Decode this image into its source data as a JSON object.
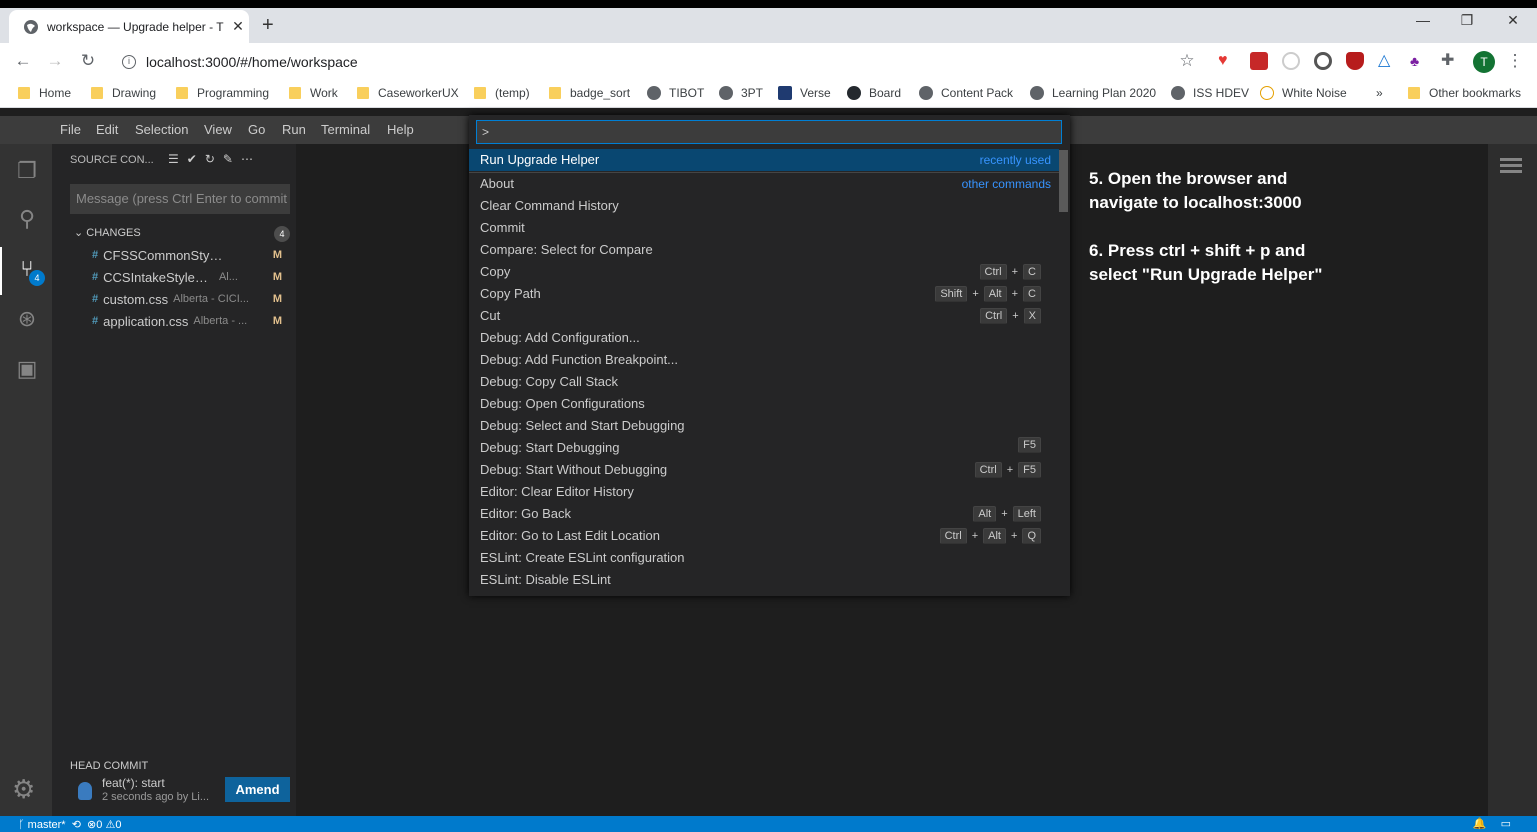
{
  "browser": {
    "tab_title": "workspace — Upgrade helper - T",
    "url": "localhost:3000/#/home/workspace",
    "bookmarks": [
      "Home",
      "Drawing",
      "Programming",
      "Work",
      "CaseworkerUX",
      "(temp)",
      "badge_sort",
      "TIBOT",
      "3PT",
      "Verse",
      "Board",
      "Content Pack",
      "Learning Plan 2020",
      "ISS HDEV",
      "White Noise"
    ],
    "other_bookmarks": "Other bookmarks",
    "more": "»",
    "avatar_letter": "T"
  },
  "menu": [
    "File",
    "Edit",
    "Selection",
    "View",
    "Go",
    "Run",
    "Terminal",
    "Help"
  ],
  "sidebar": {
    "title": "SOURCE CON...",
    "message_placeholder": "Message (press Ctrl Enter to commit",
    "changes_label": "CHANGES",
    "changes_count": "4",
    "files": [
      {
        "name": "CFSSCommonStyles.cs...",
        "desc": "",
        "status": "M"
      },
      {
        "name": "CCSIntakeStyles.css",
        "desc": "Al...",
        "status": "M"
      },
      {
        "name": "custom.css",
        "desc": "Alberta - CICI...",
        "status": "M"
      },
      {
        "name": "application.css",
        "desc": "Alberta - ...",
        "status": "M"
      }
    ],
    "head_commit_label": "HEAD COMMIT",
    "commit_message": "feat(*): start",
    "commit_sub": "2 seconds ago by Li...",
    "amend_label": "Amend",
    "scm_badge": "4"
  },
  "palette": {
    "input_value": ">",
    "items": [
      {
        "label": "Run Upgrade Helper",
        "hint": "recently used",
        "keys": []
      },
      {
        "label": "About",
        "hint": "other commands",
        "keys": []
      },
      {
        "label": "Clear Command History",
        "hint": "",
        "keys": []
      },
      {
        "label": "Commit",
        "hint": "",
        "keys": []
      },
      {
        "label": "Compare: Select for Compare",
        "hint": "",
        "keys": []
      },
      {
        "label": "Copy",
        "hint": "",
        "keys": [
          "Ctrl",
          "C"
        ]
      },
      {
        "label": "Copy Path",
        "hint": "",
        "keys": [
          "Shift",
          "Alt",
          "C"
        ]
      },
      {
        "label": "Cut",
        "hint": "",
        "keys": [
          "Ctrl",
          "X"
        ]
      },
      {
        "label": "Debug: Add Configuration...",
        "hint": "",
        "keys": []
      },
      {
        "label": "Debug: Add Function Breakpoint...",
        "hint": "",
        "keys": []
      },
      {
        "label": "Debug: Copy Call Stack",
        "hint": "",
        "keys": []
      },
      {
        "label": "Debug: Open Configurations",
        "hint": "",
        "keys": []
      },
      {
        "label": "Debug: Select and Start Debugging",
        "hint": "",
        "keys": []
      },
      {
        "label": "Debug: Start Debugging",
        "hint": "",
        "keys": [
          "F5"
        ]
      },
      {
        "label": "Debug: Start Without Debugging",
        "hint": "",
        "keys": [
          "Ctrl",
          "F5"
        ]
      },
      {
        "label": "Editor: Clear Editor History",
        "hint": "",
        "keys": []
      },
      {
        "label": "Editor: Go Back",
        "hint": "",
        "keys": [
          "Alt",
          "Left"
        ]
      },
      {
        "label": "Editor: Go to Last Edit Location",
        "hint": "",
        "keys": [
          "Ctrl",
          "Alt",
          "Q"
        ]
      },
      {
        "label": "ESLint: Create ESLint configuration",
        "hint": "",
        "keys": []
      },
      {
        "label": "ESLint: Disable ESLint",
        "hint": "",
        "keys": []
      }
    ]
  },
  "instructions": {
    "step5_line1": "5. Open the browser and",
    "step5_line2": "navigate to localhost:3000",
    "step6_line1": "6. Press ctrl + shift + p and",
    "step6_line2": "select \"Run Upgrade Helper\""
  },
  "statusbar": {
    "branch": "master*",
    "errors": "0",
    "warnings": "0"
  },
  "colors": {
    "accent": "#007acc",
    "selection": "#094771",
    "hint": "#3794ff"
  }
}
